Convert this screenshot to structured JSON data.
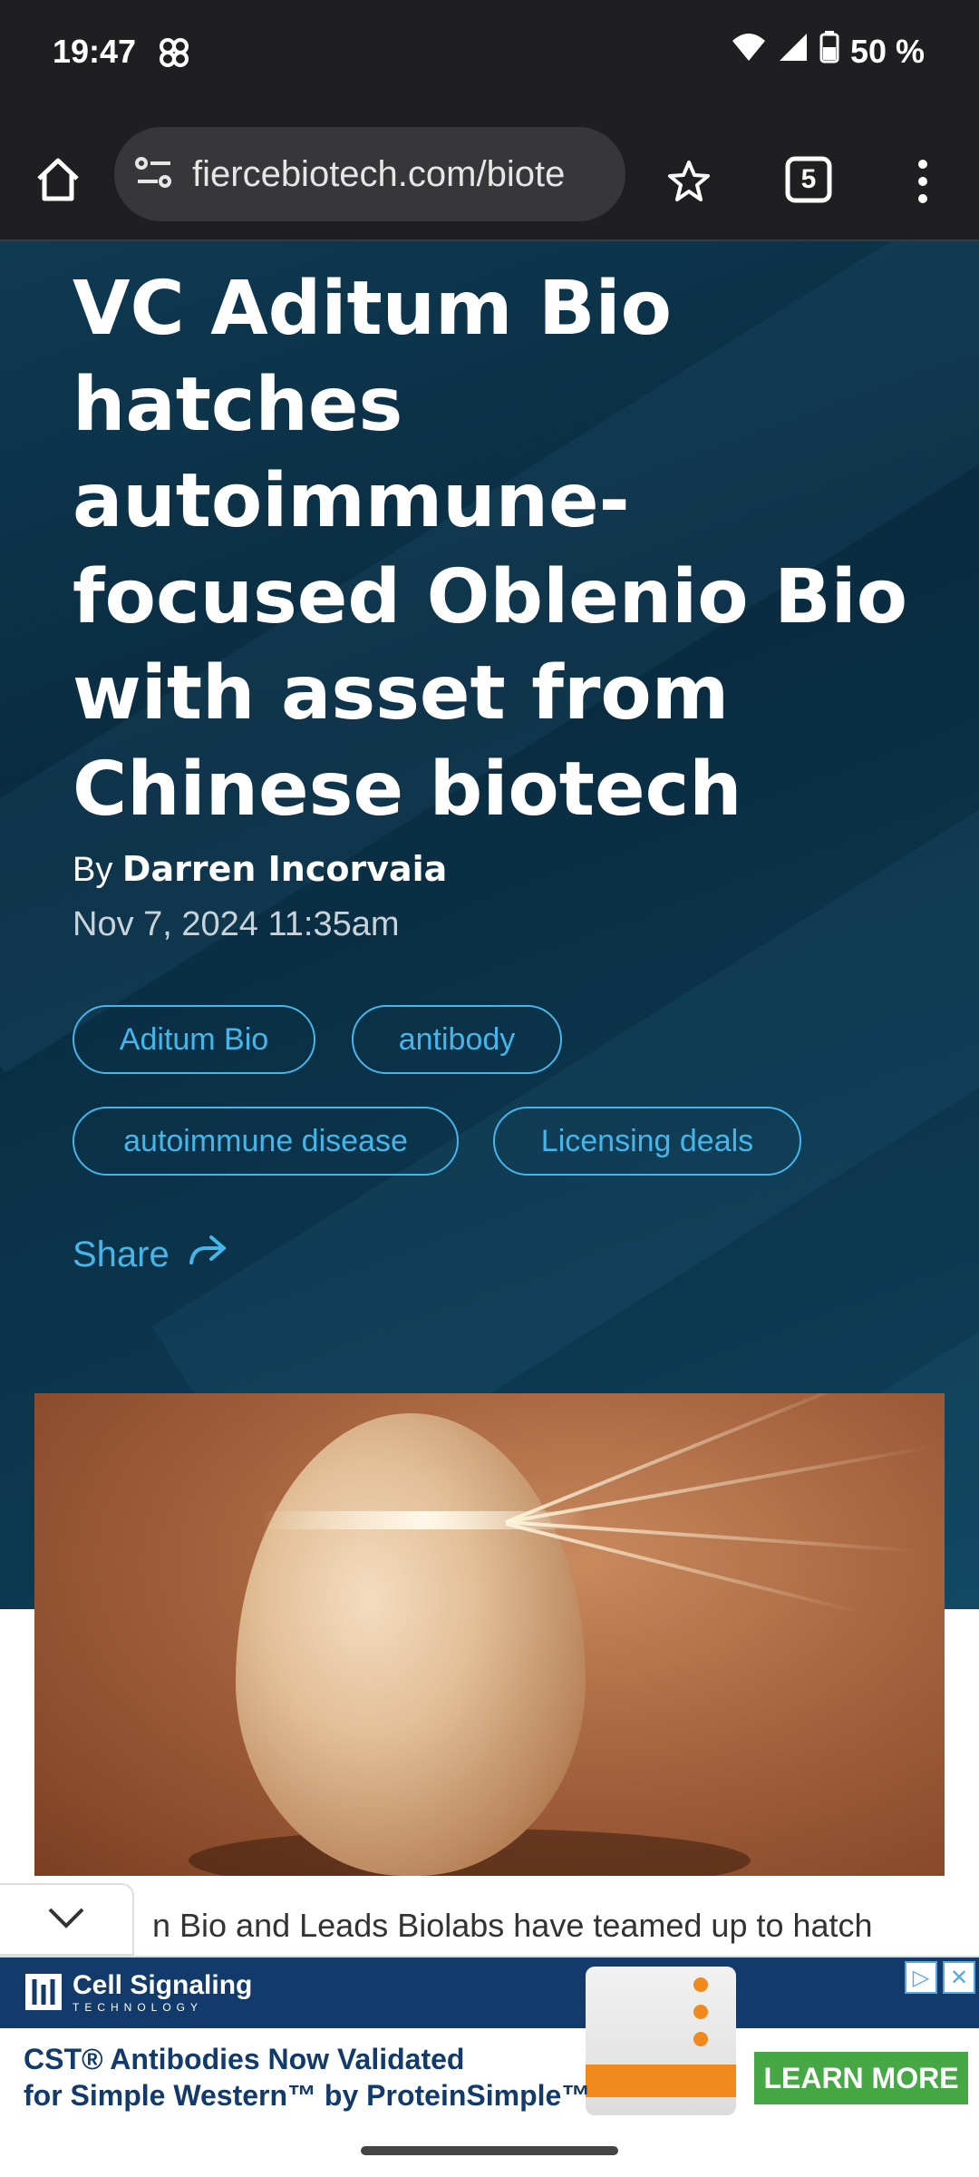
{
  "status": {
    "time": "19:47",
    "battery": "50 %"
  },
  "browser": {
    "url": "fiercebiotech.com/biote",
    "tab_count": "5"
  },
  "article": {
    "title": "VC Aditum Bio hatches autoimmune-focused Oblenio Bio with asset from Chinese biotech",
    "by_prefix": "By",
    "author": "Darren Incorvaia",
    "date": "Nov 7, 2024 11:35am",
    "tags": [
      "Aditum Bio",
      "antibody",
      "autoimmune disease",
      "Licensing deals"
    ],
    "share_label": "Share",
    "snippet": "n Bio and Leads Biolabs have teamed up to hatch"
  },
  "ad": {
    "brand": "Cell Signaling",
    "brand_sub": "TECHNOLOGY",
    "line1": "CST® Antibodies Now Validated",
    "line2": "for Simple Western™ by ProteinSimple™",
    "cta": "LEARN MORE"
  },
  "colors": {
    "accent": "#45b6ea",
    "hero_bg": "#0b3349",
    "toolbar": "#1f1f21"
  }
}
